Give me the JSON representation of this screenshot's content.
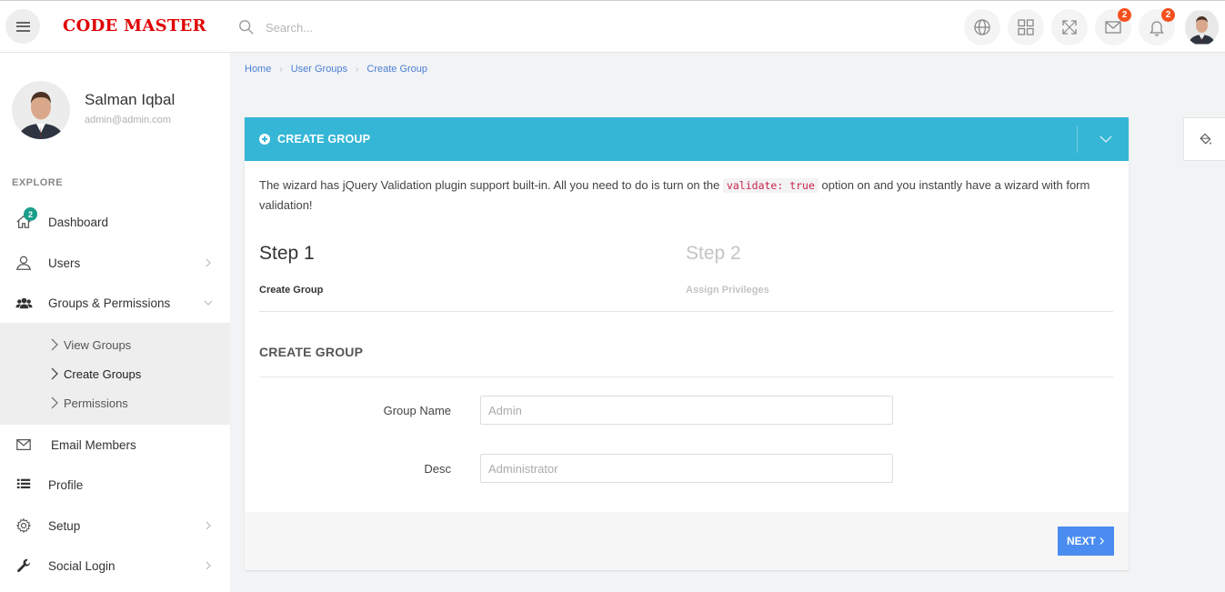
{
  "header": {
    "brand": "CODE MASTER",
    "search_placeholder": "Search...",
    "mail_count": "2",
    "notification_count": "2"
  },
  "sidebar": {
    "user_name": "Salman Iqbal",
    "user_email": "admin@admin.com",
    "section_label": "EXPLORE",
    "dashboard_badge": "2",
    "items": [
      {
        "label": "Dashboard",
        "icon": "home-icon"
      },
      {
        "label": "Users",
        "icon": "user-icon"
      },
      {
        "label": "Groups & Permissions",
        "icon": "users-icon"
      },
      {
        "label": "Email Members",
        "icon": "envelope-icon"
      },
      {
        "label": "Profile",
        "icon": "list-icon"
      },
      {
        "label": "Setup",
        "icon": "gear-icon"
      },
      {
        "label": "Social Login",
        "icon": "wrench-icon"
      }
    ],
    "submenu": [
      {
        "label": "View Groups"
      },
      {
        "label": "Create Groups"
      },
      {
        "label": "Permissions"
      }
    ]
  },
  "breadcrumb": [
    "Home",
    "User Groups",
    "Create Group"
  ],
  "card": {
    "title": "CREATE GROUP",
    "intro_before": "The wizard has jQuery Validation plugin support built-in. All you need to do is turn on the ",
    "intro_code": "validate: true",
    "intro_after": " option on and you instantly have a wizard with form validation!",
    "steps": [
      {
        "title": "Step 1",
        "subtitle": "Create Group"
      },
      {
        "title": "Step 2",
        "subtitle": "Assign Privileges"
      }
    ],
    "section_title": "CREATE GROUP",
    "fields": [
      {
        "label": "Group Name",
        "placeholder": "Admin",
        "value": ""
      },
      {
        "label": "Desc",
        "placeholder": "Administrator",
        "value": ""
      }
    ],
    "next_label": "NEXT"
  },
  "colors": {
    "accent": "#35b6d6",
    "brand": "#e00000",
    "button": "#4a8cf0",
    "badge": "#f4511e"
  }
}
